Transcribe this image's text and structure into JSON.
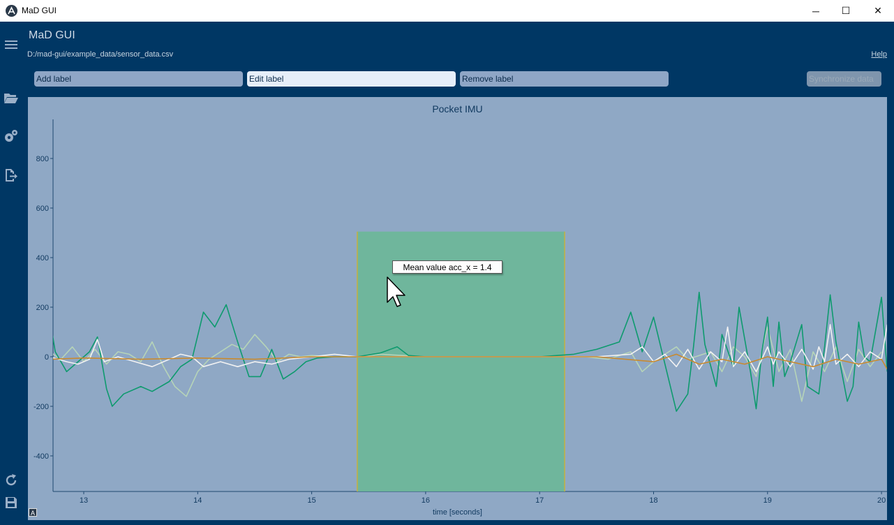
{
  "window": {
    "title": "MaD GUI",
    "minimize": "─",
    "maximize": "☐",
    "close": "✕"
  },
  "sidebar": {
    "icons": [
      "menu-icon",
      "folder-open-icon",
      "gears-icon",
      "export-icon",
      "refresh-icon",
      "save-icon"
    ]
  },
  "header": {
    "app_name": "MaD GUI",
    "file_path": "D:/mad-gui/example_data/sensor_data.csv",
    "help": "Help"
  },
  "toolbar": {
    "add_label": "Add label",
    "edit_label": "Edit label",
    "remove_label": "Remove label",
    "sync_label": "Synchronize data"
  },
  "plot": {
    "title": "Pocket IMU",
    "auto_button": "A",
    "tooltip": "Mean value acc_x = 1.4"
  },
  "chart_data": {
    "type": "line",
    "title": "Pocket IMU",
    "xlabel": "time [seconds]",
    "ylabel": "",
    "xlim": [
      12.7,
      20.05
    ],
    "ylim": [
      -545,
      960
    ],
    "x_ticks": [
      13,
      14,
      15,
      16,
      17,
      18,
      19,
      20
    ],
    "y_ticks": [
      -400,
      -200,
      0,
      200,
      400,
      600,
      800
    ],
    "grid": false,
    "label_region": {
      "start": 15.4,
      "end": 17.22,
      "max_y": 505,
      "color": "#6ab894"
    },
    "colors": {
      "series_main": "#0e9a6e",
      "series_light": "#b6d4b8",
      "series_white": "#f2f2f2",
      "series_orange": "#c98a2e",
      "series_grey": "#c0c8d0",
      "label_edge": "#c8b040"
    },
    "series": [
      {
        "color": "#b6d4b8",
        "points": [
          [
            12.7,
            20
          ],
          [
            12.8,
            -10
          ],
          [
            12.9,
            40
          ],
          [
            13.0,
            -20
          ],
          [
            13.1,
            30
          ],
          [
            13.2,
            -30
          ],
          [
            13.3,
            20
          ],
          [
            13.4,
            10
          ],
          [
            13.5,
            -20
          ],
          [
            13.6,
            60
          ],
          [
            13.7,
            -40
          ],
          [
            13.8,
            -120
          ],
          [
            13.9,
            -160
          ],
          [
            14.0,
            -60
          ],
          [
            14.1,
            -10
          ],
          [
            14.2,
            20
          ],
          [
            14.3,
            50
          ],
          [
            14.4,
            30
          ],
          [
            14.5,
            90
          ],
          [
            14.6,
            40
          ],
          [
            14.7,
            -20
          ],
          [
            14.8,
            10
          ],
          [
            14.9,
            0
          ],
          [
            15.0,
            5
          ],
          [
            15.2,
            0
          ],
          [
            15.4,
            0
          ],
          [
            15.6,
            10
          ],
          [
            15.8,
            5
          ],
          [
            16.0,
            0
          ],
          [
            16.5,
            0
          ],
          [
            17.0,
            0
          ],
          [
            17.4,
            0
          ],
          [
            17.6,
            -10
          ],
          [
            17.8,
            20
          ],
          [
            17.9,
            -60
          ],
          [
            18.0,
            -20
          ],
          [
            18.2,
            40
          ],
          [
            18.3,
            -10
          ],
          [
            18.5,
            20
          ],
          [
            18.6,
            -60
          ],
          [
            18.7,
            40
          ],
          [
            18.8,
            0
          ],
          [
            18.9,
            -80
          ],
          [
            19.0,
            120
          ],
          [
            19.1,
            -60
          ],
          [
            19.2,
            30
          ],
          [
            19.3,
            -180
          ],
          [
            19.4,
            20
          ],
          [
            19.5,
            -60
          ],
          [
            19.6,
            40
          ],
          [
            19.7,
            -100
          ],
          [
            19.8,
            30
          ],
          [
            19.9,
            -40
          ],
          [
            20.0,
            20
          ]
        ]
      },
      {
        "color": "#0e9a6e",
        "points": [
          [
            12.7,
            160
          ],
          [
            12.75,
            20
          ],
          [
            12.85,
            -60
          ],
          [
            12.95,
            -20
          ],
          [
            13.05,
            20
          ],
          [
            13.12,
            80
          ],
          [
            13.2,
            -130
          ],
          [
            13.25,
            -200
          ],
          [
            13.35,
            -150
          ],
          [
            13.5,
            -120
          ],
          [
            13.6,
            -140
          ],
          [
            13.75,
            -100
          ],
          [
            13.85,
            -40
          ],
          [
            13.95,
            -10
          ],
          [
            14.05,
            180
          ],
          [
            14.15,
            120
          ],
          [
            14.25,
            210
          ],
          [
            14.35,
            60
          ],
          [
            14.45,
            -80
          ],
          [
            14.55,
            -80
          ],
          [
            14.65,
            30
          ],
          [
            14.75,
            -90
          ],
          [
            14.85,
            -60
          ],
          [
            14.95,
            -20
          ],
          [
            15.05,
            -5
          ],
          [
            15.2,
            0
          ],
          [
            15.4,
            0
          ],
          [
            15.6,
            15
          ],
          [
            15.75,
            40
          ],
          [
            15.85,
            5
          ],
          [
            16.0,
            0
          ],
          [
            16.5,
            0
          ],
          [
            17.0,
            0
          ],
          [
            17.3,
            10
          ],
          [
            17.5,
            30
          ],
          [
            17.7,
            60
          ],
          [
            17.8,
            180
          ],
          [
            17.9,
            20
          ],
          [
            18.0,
            160
          ],
          [
            18.1,
            -30
          ],
          [
            18.2,
            -220
          ],
          [
            18.3,
            -150
          ],
          [
            18.35,
            40
          ],
          [
            18.4,
            260
          ],
          [
            18.45,
            50
          ],
          [
            18.55,
            -120
          ],
          [
            18.6,
            90
          ],
          [
            18.7,
            -40
          ],
          [
            18.75,
            200
          ],
          [
            18.85,
            -60
          ],
          [
            18.9,
            -210
          ],
          [
            18.95,
            20
          ],
          [
            19.0,
            160
          ],
          [
            19.05,
            -120
          ],
          [
            19.1,
            140
          ],
          [
            19.15,
            -80
          ],
          [
            19.2,
            -20
          ],
          [
            19.3,
            130
          ],
          [
            19.35,
            -120
          ],
          [
            19.45,
            -150
          ],
          [
            19.5,
            40
          ],
          [
            19.55,
            250
          ],
          [
            19.6,
            60
          ],
          [
            19.7,
            -180
          ],
          [
            19.75,
            -120
          ],
          [
            19.8,
            140
          ],
          [
            19.85,
            0
          ],
          [
            19.9,
            -20
          ],
          [
            20.0,
            240
          ],
          [
            20.05,
            -60
          ]
        ]
      },
      {
        "color": "#f2f2f2",
        "points": [
          [
            12.7,
            0
          ],
          [
            12.85,
            -20
          ],
          [
            12.95,
            -30
          ],
          [
            13.05,
            -10
          ],
          [
            13.12,
            70
          ],
          [
            13.18,
            -20
          ],
          [
            13.3,
            0
          ],
          [
            13.45,
            -20
          ],
          [
            13.6,
            -40
          ],
          [
            13.75,
            -10
          ],
          [
            13.85,
            10
          ],
          [
            13.95,
            0
          ],
          [
            14.05,
            -40
          ],
          [
            14.2,
            -20
          ],
          [
            14.35,
            -40
          ],
          [
            14.5,
            -20
          ],
          [
            14.65,
            -30
          ],
          [
            14.8,
            -10
          ],
          [
            15.0,
            0
          ],
          [
            15.2,
            10
          ],
          [
            15.4,
            0
          ],
          [
            16.0,
            0
          ],
          [
            17.0,
            0
          ],
          [
            17.5,
            0
          ],
          [
            17.8,
            10
          ],
          [
            17.9,
            40
          ],
          [
            18.0,
            -20
          ],
          [
            18.1,
            10
          ],
          [
            18.2,
            -40
          ],
          [
            18.3,
            30
          ],
          [
            18.4,
            -50
          ],
          [
            18.5,
            20
          ],
          [
            18.6,
            -20
          ],
          [
            18.65,
            120
          ],
          [
            18.7,
            -40
          ],
          [
            18.8,
            20
          ],
          [
            18.9,
            -60
          ],
          [
            19.0,
            40
          ],
          [
            19.05,
            -30
          ],
          [
            19.1,
            20
          ],
          [
            19.2,
            -40
          ],
          [
            19.3,
            30
          ],
          [
            19.4,
            -50
          ],
          [
            19.45,
            40
          ],
          [
            19.5,
            -20
          ],
          [
            19.55,
            130
          ],
          [
            19.6,
            -30
          ],
          [
            19.7,
            10
          ],
          [
            19.8,
            -40
          ],
          [
            19.9,
            20
          ],
          [
            20.0,
            -10
          ],
          [
            20.05,
            130
          ]
        ]
      },
      {
        "color": "#c98a2e",
        "points": [
          [
            12.7,
            -10
          ],
          [
            13.0,
            -5
          ],
          [
            13.5,
            -10
          ],
          [
            14.0,
            -5
          ],
          [
            14.5,
            -10
          ],
          [
            15.0,
            0
          ],
          [
            15.5,
            0
          ],
          [
            16.0,
            0
          ],
          [
            16.5,
            0
          ],
          [
            17.0,
            0
          ],
          [
            17.5,
            0
          ],
          [
            18.0,
            -20
          ],
          [
            18.2,
            10
          ],
          [
            18.4,
            -30
          ],
          [
            18.6,
            -10
          ],
          [
            18.8,
            -30
          ],
          [
            19.0,
            0
          ],
          [
            19.2,
            -20
          ],
          [
            19.4,
            -40
          ],
          [
            19.6,
            -10
          ],
          [
            19.8,
            -30
          ],
          [
            20.0,
            -10
          ],
          [
            20.05,
            -50
          ]
        ]
      }
    ]
  }
}
